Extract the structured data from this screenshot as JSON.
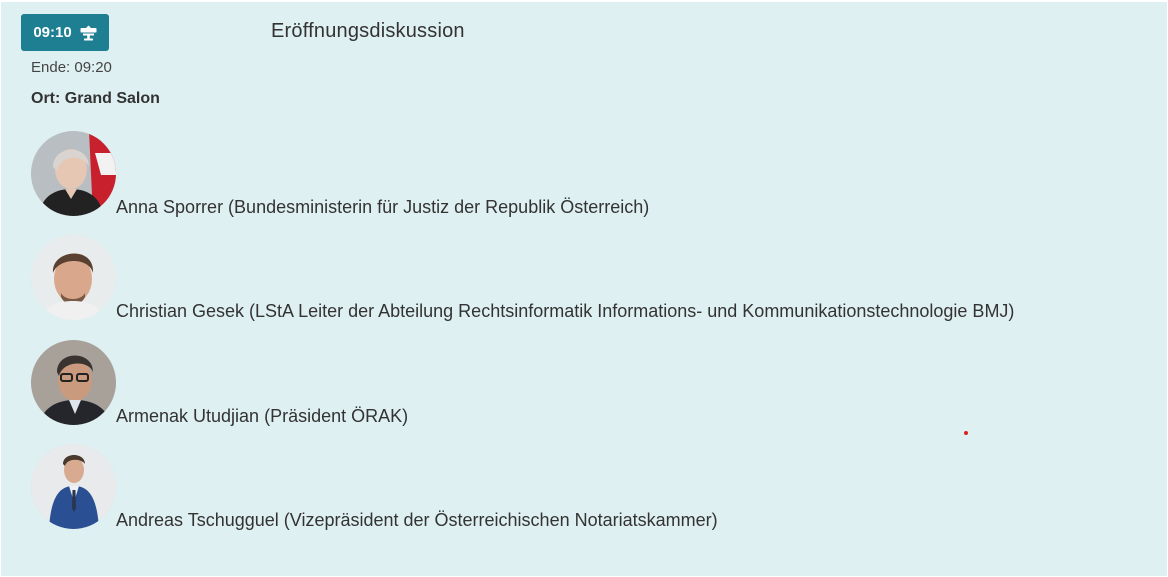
{
  "session": {
    "start_time": "09:10",
    "badge_icon": "podium-icon",
    "title": "Eröffnungsdiskussion",
    "end_label": "Ende: 09:20",
    "location_label": "Ort: Grand Salon"
  },
  "speakers": [
    {
      "label": "Anna Sporrer (Bundesministerin für Justiz der Republik Österreich)"
    },
    {
      "label": "Christian Gesek (LStA Leiter der Abteilung Rechtsinformatik Informations- und Kommunikationstechnologie BMJ)"
    },
    {
      "label": "Armenak Utudjian (Präsident ÖRAK)"
    },
    {
      "label": "Andreas Tschugguel (Vizepräsident der Österreichischen Notariatskammer)"
    }
  ],
  "colors": {
    "card_background": "#dff0f2",
    "badge_background": "#1e7f93",
    "text": "#333333",
    "marker": "#e02020"
  }
}
